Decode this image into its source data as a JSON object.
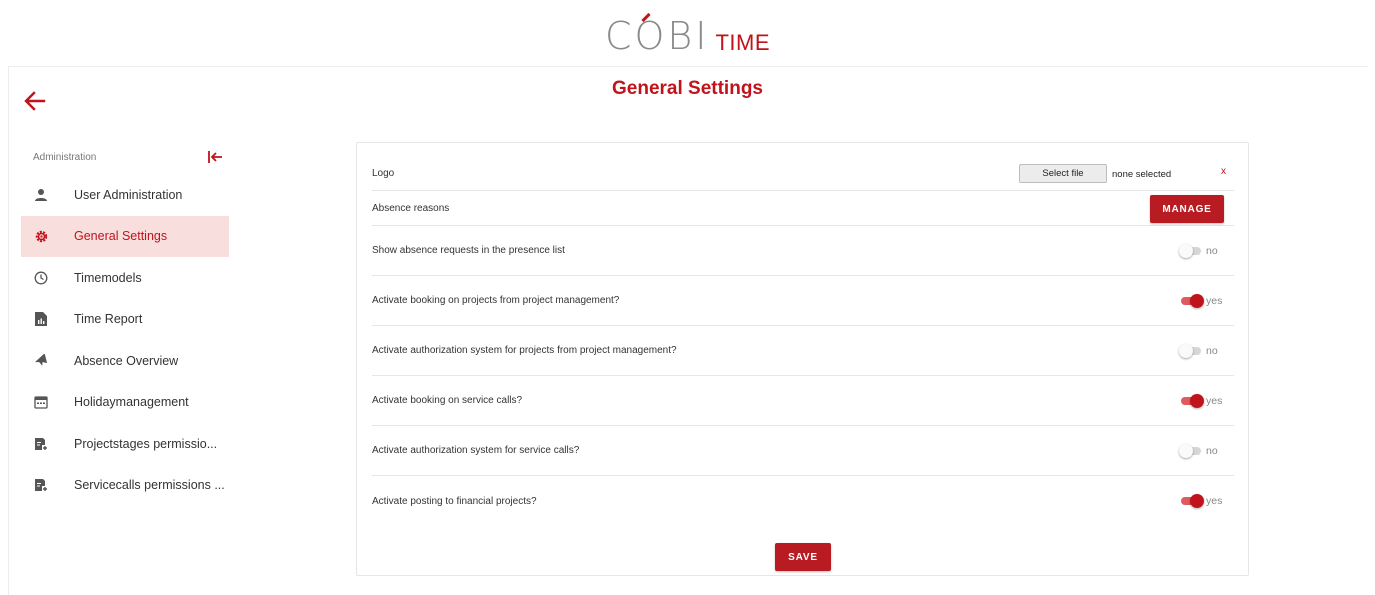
{
  "brand": {
    "main": "COBI",
    "sub": "TIME",
    "accent_color": "#c0131b"
  },
  "header": {
    "back_icon": "arrow-left-icon",
    "title": "General Settings"
  },
  "sidebar": {
    "section_label": "Administration",
    "collapse_icon": "collapse-left-icon",
    "items": [
      {
        "label": "User Administration",
        "icon": "user-icon",
        "active": false
      },
      {
        "label": "General Settings",
        "icon": "gear-icon",
        "active": true
      },
      {
        "label": "Timemodels",
        "icon": "clock-icon",
        "active": false
      },
      {
        "label": "Time Report",
        "icon": "report-icon",
        "active": false
      },
      {
        "label": "Absence Overview",
        "icon": "airplane-icon",
        "active": false
      },
      {
        "label": "Holidaymanagement",
        "icon": "calendar-icon",
        "active": false
      },
      {
        "label": "Projectstages permissio...",
        "icon": "permission-icon",
        "active": false
      },
      {
        "label": "Servicecalls permissions ...",
        "icon": "permission-icon",
        "active": false
      }
    ]
  },
  "settings": {
    "logo": {
      "label": "Logo",
      "button": "Select file",
      "status": "none selected",
      "clear": "x"
    },
    "absence_reasons": {
      "label": "Absence reasons",
      "button": "MANAGE"
    },
    "toggles": [
      {
        "label": "Show absence requests in the presence list",
        "on": false,
        "state": "no"
      },
      {
        "label": "Activate booking on projects from project management?",
        "on": true,
        "state": "yes"
      },
      {
        "label": "Activate authorization system for projects from project management?",
        "on": false,
        "state": "no"
      },
      {
        "label": "Activate booking on service calls?",
        "on": true,
        "state": "yes"
      },
      {
        "label": "Activate authorization system for service calls?",
        "on": false,
        "state": "no"
      },
      {
        "label": "Activate posting to financial projects?",
        "on": true,
        "state": "yes"
      }
    ],
    "save_label": "SAVE"
  }
}
